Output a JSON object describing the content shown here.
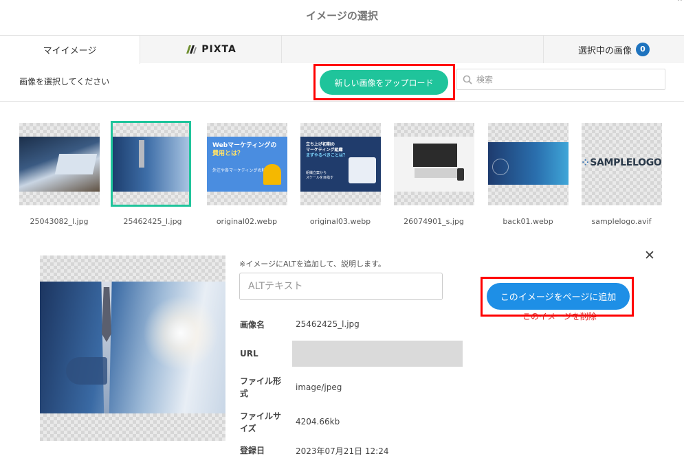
{
  "dialog": {
    "title": "イメージの選択"
  },
  "tabs": {
    "my_images": "マイイメージ",
    "pixta": "PIXTA",
    "selected": "選択中の画像",
    "selected_count": "0"
  },
  "toolbar": {
    "hint": "画像を選択してください",
    "upload_label": "新しい画像をアップロード",
    "search_placeholder": "検索"
  },
  "gallery": [
    {
      "file": "25043082_l.jpg"
    },
    {
      "file": "25462425_l.jpg",
      "selected": true
    },
    {
      "file": "original02.webp",
      "banner": [
        "Webマーケティングの",
        "費用とは？"
      ],
      "banner_sub": "外注や各マーケティングの料金相場"
    },
    {
      "file": "original03.webp",
      "banner": [
        "立ち上げ初期の",
        "マーケティング組織",
        "まずやるべきことは？"
      ],
      "banner_sub": "組織立案から\nスケールを目指す"
    },
    {
      "file": "26074901_s.jpg"
    },
    {
      "file": "back01.webp"
    },
    {
      "file": "samplelogo.avif",
      "logo_text": "SAMPLELOGO"
    }
  ],
  "detail": {
    "alt_note": "※イメージにALTを追加して、説明します。",
    "alt_placeholder": "ALTテキスト",
    "add_label": "このイメージをページに追加",
    "delete_label": "このイメージを削除",
    "labels": {
      "name": "画像名",
      "url": "URL",
      "file_type": "ファイル形式",
      "file_size": "ファイルサイズ",
      "date": "登録日"
    },
    "values": {
      "name": "25462425_l.jpg",
      "url": "",
      "file_type": "image/jpeg",
      "file_size": "4204.66kb",
      "date": "2023年07月21日 12:24"
    }
  },
  "colors": {
    "upload_button": "#1fc49b",
    "add_button": "#1e8fe6",
    "highlight_frame": "#ff0000",
    "badge": "#1e73be",
    "delete_link": "#e02020"
  }
}
